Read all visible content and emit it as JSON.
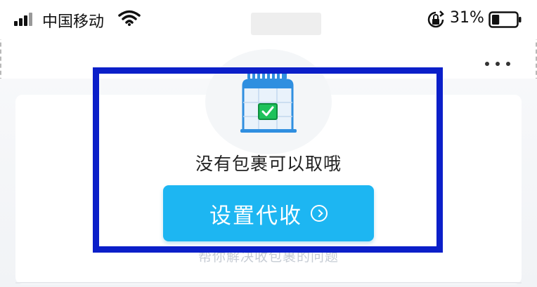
{
  "status_bar": {
    "carrier": "中国移动",
    "battery_percent": "31%",
    "battery_level": 0.31,
    "icons": [
      "signal-icon",
      "wifi-icon",
      "orientation-lock-icon",
      "battery-icon"
    ]
  },
  "header": {
    "more_icon": "more-icon"
  },
  "empty_state": {
    "icon": "parcel-locker-icon",
    "message": "没有包裹可以取哦"
  },
  "action": {
    "label": "设置代收",
    "icon": "chevron-right-circle-icon"
  },
  "hint": {
    "text": "帮你解决收包裹的问题"
  },
  "colors": {
    "accent": "#1db6f2",
    "highlight_border": "#0b1fc9",
    "check_green": "#1ec25b"
  }
}
